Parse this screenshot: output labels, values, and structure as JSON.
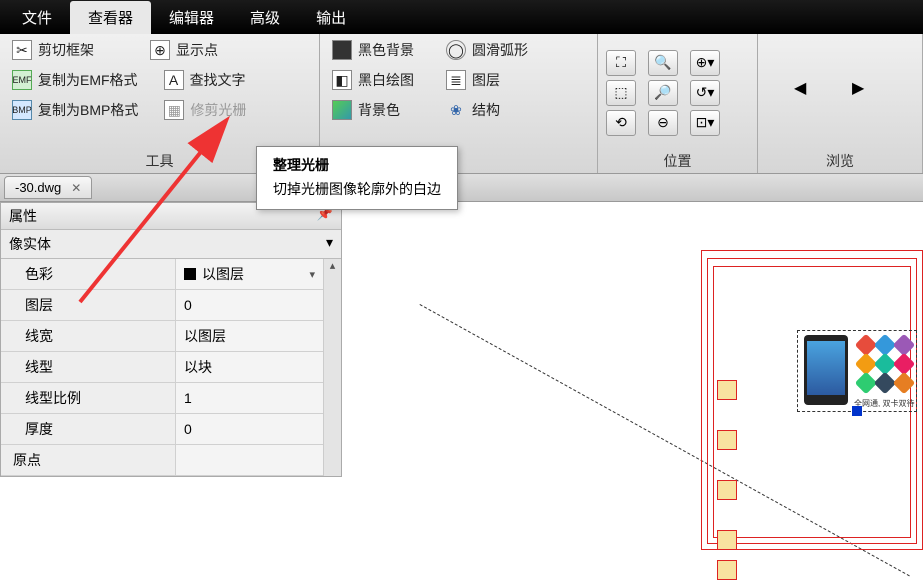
{
  "menu": {
    "tabs": [
      "文件",
      "查看器",
      "编辑器",
      "高级",
      "输出"
    ],
    "active_index": 1
  },
  "ribbon": {
    "groups": {
      "tools": {
        "label": "工具",
        "items": {
          "clip_frame": "剪切框架",
          "copy_emf": "复制为EMF格式",
          "copy_bmp": "复制为BMP格式",
          "show_points": "显示点",
          "find_text": "查找文字",
          "trim_raster": "修剪光栅"
        }
      },
      "display": {
        "items": {
          "black_bg": "黑色背景",
          "bw_draw": "黑白绘图",
          "bg_color": "背景色",
          "smooth_arc": "圆滑弧形",
          "layers": "图层",
          "structure": "结构"
        }
      },
      "position": {
        "label": "位置"
      },
      "browse": {
        "label": "浏览"
      }
    }
  },
  "doc_tab": {
    "name": "-30.dwg"
  },
  "properties": {
    "panel_title": "属性",
    "entity_type": "像实体",
    "rows": {
      "color_label": "色彩",
      "color_value": "以图层",
      "layer_label": "图层",
      "layer_value": "0",
      "lineweight_label": "线宽",
      "lineweight_value": "以图层",
      "linetype_label": "线型",
      "linetype_value": "以块",
      "ltscale_label": "线型比例",
      "ltscale_value": "1",
      "thickness_label": "厚度",
      "thickness_value": "0",
      "origin_label": "原点"
    }
  },
  "tooltip": {
    "title": "整理光栅",
    "desc": "切掉光栅图像轮廓外的白边"
  },
  "image_caption": "全网通, 双卡双待"
}
